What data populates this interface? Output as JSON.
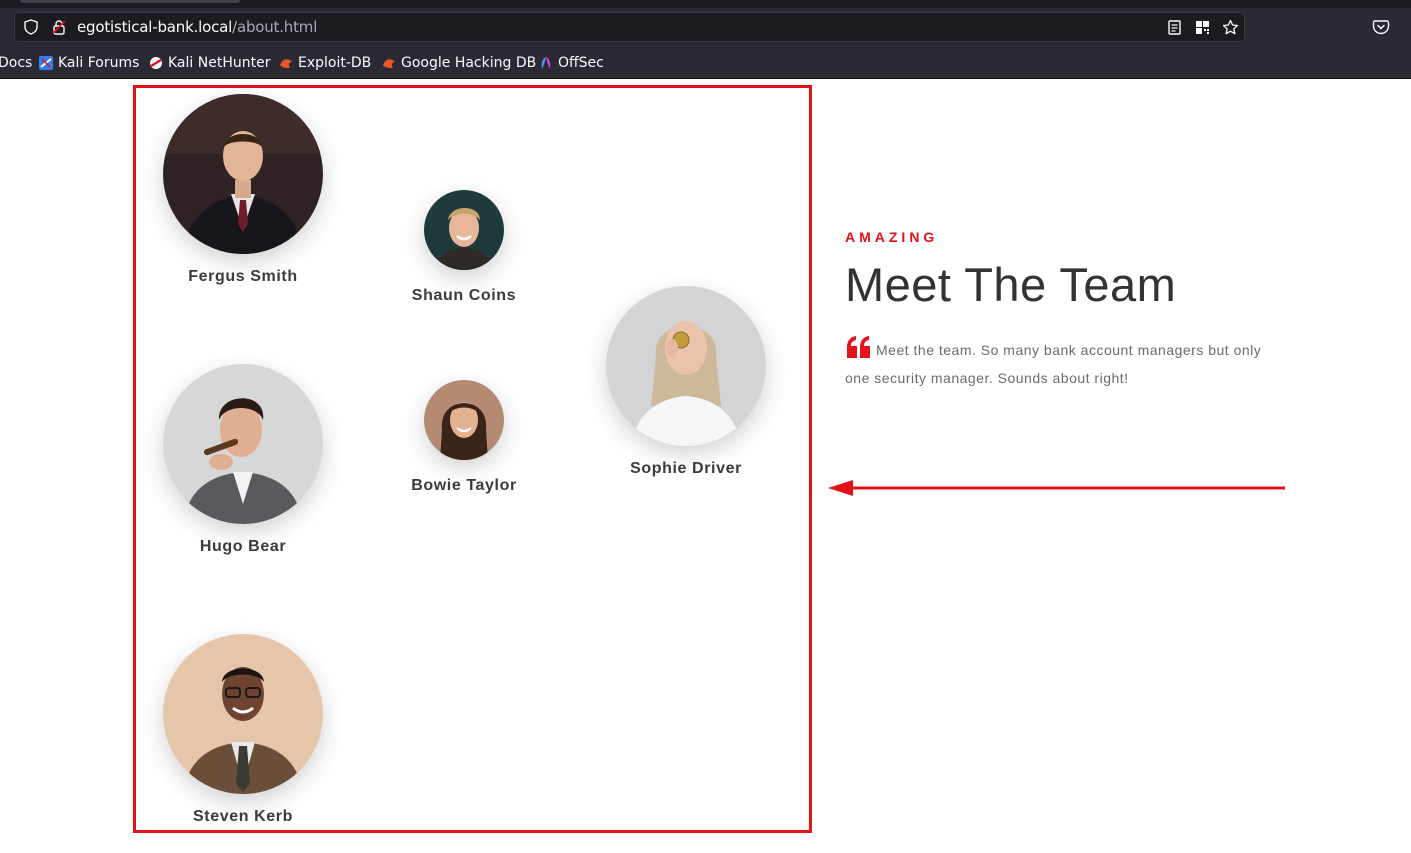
{
  "browser": {
    "url_domain": "egotistical-bank.local",
    "url_path": "/about.html",
    "bookmarks": [
      {
        "label": "Docs",
        "icon": "doc-icon"
      },
      {
        "label": "Kali Forums",
        "icon": "kali-forums-icon"
      },
      {
        "label": "Kali NetHunter",
        "icon": "nethunter-icon"
      },
      {
        "label": "Exploit-DB",
        "icon": "exploit-db-icon"
      },
      {
        "label": "Google Hacking DB",
        "icon": "ghdb-icon"
      },
      {
        "label": "OffSec",
        "icon": "offsec-icon"
      }
    ]
  },
  "team": {
    "members": [
      {
        "name": "Fergus Smith"
      },
      {
        "name": "Shaun Coins"
      },
      {
        "name": "Sophie Driver"
      },
      {
        "name": "Hugo Bear"
      },
      {
        "name": "Bowie Taylor"
      },
      {
        "name": "Steven Kerb"
      }
    ]
  },
  "intro": {
    "eyebrow": "AMAZING",
    "title": "Meet The Team",
    "quote": "Meet the team. So many bank account managers but only one security manager. Sounds about right!"
  },
  "colors": {
    "accent": "#e3111a",
    "annotation": "#e3111a",
    "heading": "#333333",
    "body_text": "#6b6b6b",
    "chrome_dark": "#1c1b22",
    "chrome_toolbar": "#2b2a33"
  }
}
